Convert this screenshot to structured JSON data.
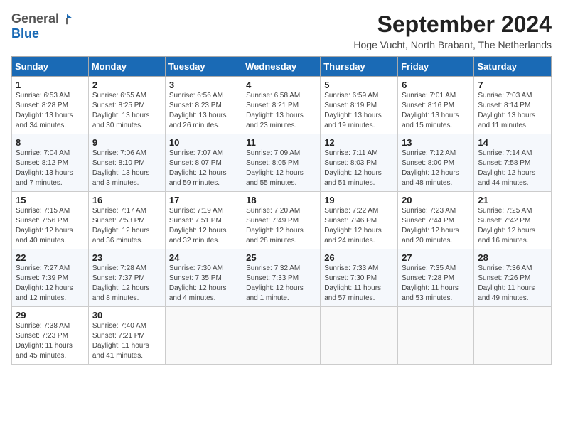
{
  "header": {
    "logo_general": "General",
    "logo_blue": "Blue",
    "month_title": "September 2024",
    "subtitle": "Hoge Vucht, North Brabant, The Netherlands"
  },
  "weekdays": [
    "Sunday",
    "Monday",
    "Tuesday",
    "Wednesday",
    "Thursday",
    "Friday",
    "Saturday"
  ],
  "weeks": [
    [
      {
        "day": "1",
        "info": "Sunrise: 6:53 AM\nSunset: 8:28 PM\nDaylight: 13 hours\nand 34 minutes."
      },
      {
        "day": "2",
        "info": "Sunrise: 6:55 AM\nSunset: 8:25 PM\nDaylight: 13 hours\nand 30 minutes."
      },
      {
        "day": "3",
        "info": "Sunrise: 6:56 AM\nSunset: 8:23 PM\nDaylight: 13 hours\nand 26 minutes."
      },
      {
        "day": "4",
        "info": "Sunrise: 6:58 AM\nSunset: 8:21 PM\nDaylight: 13 hours\nand 23 minutes."
      },
      {
        "day": "5",
        "info": "Sunrise: 6:59 AM\nSunset: 8:19 PM\nDaylight: 13 hours\nand 19 minutes."
      },
      {
        "day": "6",
        "info": "Sunrise: 7:01 AM\nSunset: 8:16 PM\nDaylight: 13 hours\nand 15 minutes."
      },
      {
        "day": "7",
        "info": "Sunrise: 7:03 AM\nSunset: 8:14 PM\nDaylight: 13 hours\nand 11 minutes."
      }
    ],
    [
      {
        "day": "8",
        "info": "Sunrise: 7:04 AM\nSunset: 8:12 PM\nDaylight: 13 hours\nand 7 minutes."
      },
      {
        "day": "9",
        "info": "Sunrise: 7:06 AM\nSunset: 8:10 PM\nDaylight: 13 hours\nand 3 minutes."
      },
      {
        "day": "10",
        "info": "Sunrise: 7:07 AM\nSunset: 8:07 PM\nDaylight: 12 hours\nand 59 minutes."
      },
      {
        "day": "11",
        "info": "Sunrise: 7:09 AM\nSunset: 8:05 PM\nDaylight: 12 hours\nand 55 minutes."
      },
      {
        "day": "12",
        "info": "Sunrise: 7:11 AM\nSunset: 8:03 PM\nDaylight: 12 hours\nand 51 minutes."
      },
      {
        "day": "13",
        "info": "Sunrise: 7:12 AM\nSunset: 8:00 PM\nDaylight: 12 hours\nand 48 minutes."
      },
      {
        "day": "14",
        "info": "Sunrise: 7:14 AM\nSunset: 7:58 PM\nDaylight: 12 hours\nand 44 minutes."
      }
    ],
    [
      {
        "day": "15",
        "info": "Sunrise: 7:15 AM\nSunset: 7:56 PM\nDaylight: 12 hours\nand 40 minutes."
      },
      {
        "day": "16",
        "info": "Sunrise: 7:17 AM\nSunset: 7:53 PM\nDaylight: 12 hours\nand 36 minutes."
      },
      {
        "day": "17",
        "info": "Sunrise: 7:19 AM\nSunset: 7:51 PM\nDaylight: 12 hours\nand 32 minutes."
      },
      {
        "day": "18",
        "info": "Sunrise: 7:20 AM\nSunset: 7:49 PM\nDaylight: 12 hours\nand 28 minutes."
      },
      {
        "day": "19",
        "info": "Sunrise: 7:22 AM\nSunset: 7:46 PM\nDaylight: 12 hours\nand 24 minutes."
      },
      {
        "day": "20",
        "info": "Sunrise: 7:23 AM\nSunset: 7:44 PM\nDaylight: 12 hours\nand 20 minutes."
      },
      {
        "day": "21",
        "info": "Sunrise: 7:25 AM\nSunset: 7:42 PM\nDaylight: 12 hours\nand 16 minutes."
      }
    ],
    [
      {
        "day": "22",
        "info": "Sunrise: 7:27 AM\nSunset: 7:39 PM\nDaylight: 12 hours\nand 12 minutes."
      },
      {
        "day": "23",
        "info": "Sunrise: 7:28 AM\nSunset: 7:37 PM\nDaylight: 12 hours\nand 8 minutes."
      },
      {
        "day": "24",
        "info": "Sunrise: 7:30 AM\nSunset: 7:35 PM\nDaylight: 12 hours\nand 4 minutes."
      },
      {
        "day": "25",
        "info": "Sunrise: 7:32 AM\nSunset: 7:33 PM\nDaylight: 12 hours\nand 1 minute."
      },
      {
        "day": "26",
        "info": "Sunrise: 7:33 AM\nSunset: 7:30 PM\nDaylight: 11 hours\nand 57 minutes."
      },
      {
        "day": "27",
        "info": "Sunrise: 7:35 AM\nSunset: 7:28 PM\nDaylight: 11 hours\nand 53 minutes."
      },
      {
        "day": "28",
        "info": "Sunrise: 7:36 AM\nSunset: 7:26 PM\nDaylight: 11 hours\nand 49 minutes."
      }
    ],
    [
      {
        "day": "29",
        "info": "Sunrise: 7:38 AM\nSunset: 7:23 PM\nDaylight: 11 hours\nand 45 minutes."
      },
      {
        "day": "30",
        "info": "Sunrise: 7:40 AM\nSunset: 7:21 PM\nDaylight: 11 hours\nand 41 minutes."
      },
      null,
      null,
      null,
      null,
      null
    ]
  ]
}
